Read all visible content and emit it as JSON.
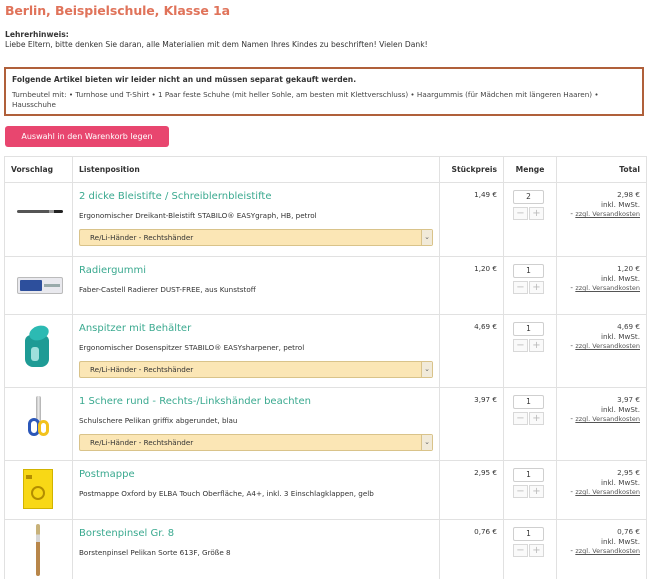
{
  "page": {
    "title": "Berlin, Beispielschule, Klasse 1a"
  },
  "teacher_note": {
    "label": "Lehrerhinweis:",
    "text": "Liebe Eltern, bitte denken Sie daran, alle Materialien mit dem Namen Ihres Kindes zu beschriften! Vielen Dank!"
  },
  "notice": {
    "title": "Folgende Artikel bieten wir leider nicht an und müssen separat gekauft werden.",
    "text": "Turnbeutel mit: • Turnhose und T-Shirt • 1 Paar feste Schuhe (mit heller Sohle, am besten mit Klettverschluss) • Haargummis (für Mädchen mit längeren Haaren) • Hausschuhe"
  },
  "cart_button_label": "Auswahl in den Warenkorb legen",
  "table": {
    "headers": {
      "suggestion": "Vorschlag",
      "position": "Listenposition",
      "unit_price": "Stückpreis",
      "quantity": "Menge",
      "total": "Total"
    },
    "vat_label": "inkl. MwSt.",
    "shipping_prefix": "- ",
    "shipping_label": "zzgl. Versandkosten",
    "minus": "−",
    "plus": "+",
    "caret": "⌄",
    "rows": [
      {
        "name": "2 dicke Bleistifte / Schreiblernbleistifte",
        "description": "Ergonomischer Dreikant-Bleistift STABILO® EASYgraph, HB, petrol",
        "variant": "Re/Li-Händer - Rechtshänder",
        "unit_price": "1,49 €",
        "quantity": "2",
        "total": "2,98 €",
        "image": "pencil-image"
      },
      {
        "name": "Radiergummi",
        "description": "Faber-Castell Radierer DUST-FREE, aus Kunststoff",
        "variant": "",
        "unit_price": "1,20 €",
        "quantity": "1",
        "total": "1,20 €",
        "image": "eraser-image"
      },
      {
        "name": "Anspitzer mit Behälter",
        "description": "Ergonomischer Dosenspitzer STABILO® EASYsharpener, petrol",
        "variant": "Re/Li-Händer - Rechtshänder",
        "unit_price": "4,69 €",
        "quantity": "1",
        "total": "4,69 €",
        "image": "sharpener-image"
      },
      {
        "name": "1 Schere rund - Rechts-/Linkshänder beachten",
        "description": "Schulschere Pelikan griffix abgerundet, blau",
        "variant": "Re/Li-Händer - Rechtshänder",
        "unit_price": "3,97 €",
        "quantity": "1",
        "total": "3,97 €",
        "image": "scissors-image"
      },
      {
        "name": "Postmappe",
        "description": "Postmappe Oxford by ELBA Touch Oberfläche, A4+, inkl. 3 Einschlagklappen, gelb",
        "variant": "",
        "unit_price": "2,95 €",
        "quantity": "1",
        "total": "2,95 €",
        "image": "folder-image"
      },
      {
        "name": "Borstenpinsel Gr. 8",
        "description": "Borstenpinsel Pelikan Sorte 613F, Größe 8",
        "variant": "",
        "unit_price": "0,76 €",
        "quantity": "1",
        "total": "0,76 €",
        "image": "brush-image"
      }
    ]
  },
  "colors": {
    "title": "#e0735a",
    "product_link": "#3aa98f",
    "button": "#e8466f",
    "notice_border": "#b0603a",
    "variant_bg": "#fbe6b5"
  }
}
